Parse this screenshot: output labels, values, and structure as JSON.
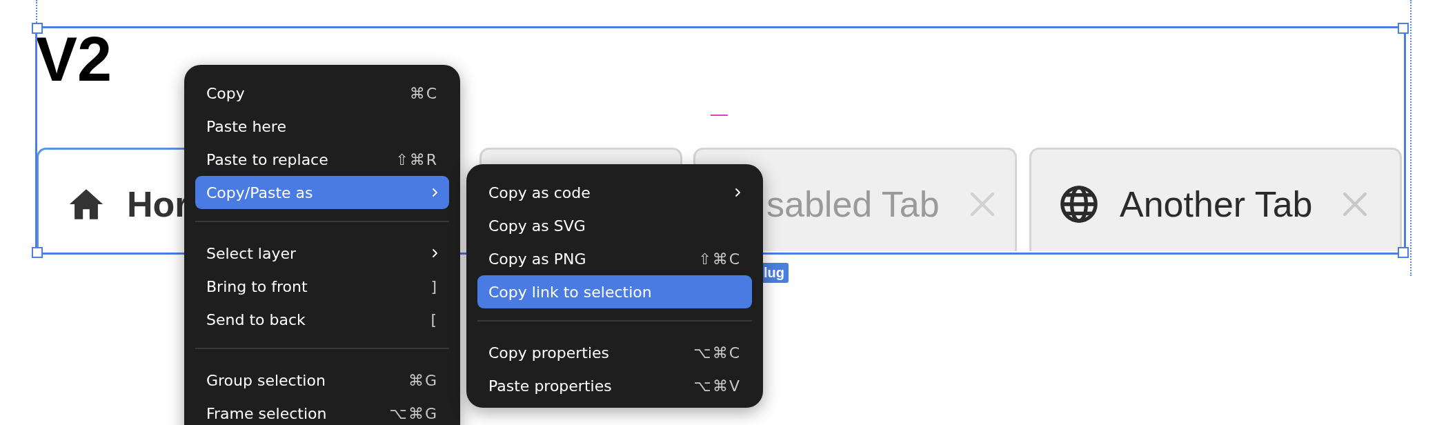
{
  "canvas": {
    "heading": "V2",
    "badge": "lug"
  },
  "tabs": [
    {
      "label": "Hor",
      "selected": true,
      "disabled": false,
      "closable": false
    },
    {
      "selected": false
    },
    {
      "label": "sabled Tab",
      "selected": false,
      "disabled": true,
      "closable": true
    },
    {
      "label": "Another Tab",
      "selected": false,
      "disabled": false,
      "closable": true
    }
  ],
  "context_menu": {
    "items": [
      {
        "kind": "item",
        "label": "Copy",
        "shortcut": "⌘C",
        "selected": false,
        "submenu": false
      },
      {
        "kind": "item",
        "label": "Paste here",
        "selected": false,
        "submenu": false
      },
      {
        "kind": "item",
        "label": "Paste to replace",
        "shortcut": "⇧⌘R",
        "selected": false,
        "submenu": false
      },
      {
        "kind": "item",
        "label": "Copy/Paste as",
        "selected": true,
        "submenu": true
      },
      {
        "kind": "separator"
      },
      {
        "kind": "item",
        "label": "Select layer",
        "selected": false,
        "submenu": true
      },
      {
        "kind": "item",
        "label": "Bring to front",
        "shortcut": "]",
        "selected": false,
        "submenu": false
      },
      {
        "kind": "item",
        "label": "Send to back",
        "shortcut": "[",
        "selected": false,
        "submenu": false
      },
      {
        "kind": "separator"
      },
      {
        "kind": "item",
        "label": "Group selection",
        "shortcut": "⌘G",
        "selected": false,
        "submenu": false
      },
      {
        "kind": "item",
        "label": "Frame selection",
        "shortcut": "⌥⌘G",
        "selected": false,
        "submenu": false
      }
    ]
  },
  "submenu": {
    "items": [
      {
        "kind": "item",
        "label": "Copy as code",
        "selected": false,
        "submenu": true
      },
      {
        "kind": "item",
        "label": "Copy as SVG",
        "selected": false,
        "submenu": false
      },
      {
        "kind": "item",
        "label": "Copy as PNG",
        "shortcut": "⇧⌘C",
        "selected": false,
        "submenu": false
      },
      {
        "kind": "item",
        "label": "Copy link to selection",
        "selected": true,
        "submenu": false
      },
      {
        "kind": "separator"
      },
      {
        "kind": "item",
        "label": "Copy properties",
        "shortcut": "⌥⌘C",
        "selected": false,
        "submenu": false
      },
      {
        "kind": "item",
        "label": "Paste properties",
        "shortcut": "⌥⌘V",
        "selected": false,
        "submenu": false
      }
    ]
  }
}
